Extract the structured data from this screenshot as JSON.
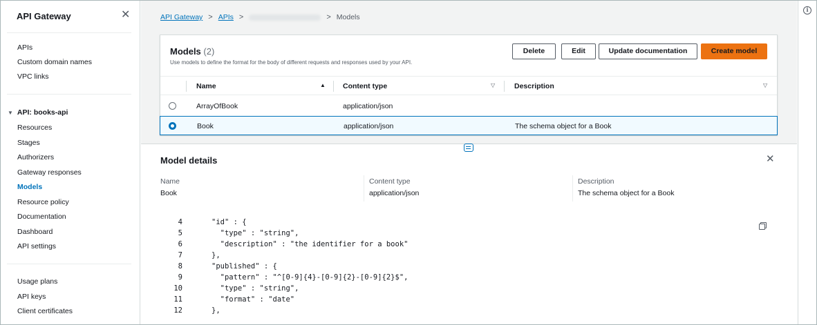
{
  "sidebar": {
    "title": "API Gateway",
    "close_glyph": "✕",
    "top_items": [
      "APIs",
      "Custom domain names",
      "VPC links"
    ],
    "api_section": "API: books-api",
    "api_items": [
      "Resources",
      "Stages",
      "Authorizers",
      "Gateway responses",
      "Models",
      "Resource policy",
      "Documentation",
      "Dashboard",
      "API settings"
    ],
    "active_item": "Models",
    "bottom_items": [
      "Usage plans",
      "API keys",
      "Client certificates"
    ]
  },
  "breadcrumb": {
    "root": "API Gateway",
    "apis": "APIs",
    "current": "Models",
    "sep": ">"
  },
  "models_panel": {
    "title": "Models",
    "count": "(2)",
    "subtitle": "Use models to define the format for the body of different requests and responses used by your API.",
    "buttons": {
      "delete": "Delete",
      "edit": "Edit",
      "update_docs": "Update documentation",
      "create": "Create model"
    },
    "columns": [
      "Name",
      "Content type",
      "Description"
    ],
    "rows": [
      {
        "name": "ArrayOfBook",
        "content_type": "application/json",
        "description": "",
        "selected": false
      },
      {
        "name": "Book",
        "content_type": "application/json",
        "description": "The schema object for a Book",
        "selected": true
      }
    ]
  },
  "details": {
    "title": "Model details",
    "close_glyph": "✕",
    "fields": [
      {
        "label": "Name",
        "value": "Book"
      },
      {
        "label": "Content type",
        "value": "application/json"
      },
      {
        "label": "Description",
        "value": "The schema object for a Book"
      }
    ],
    "code_lines": [
      {
        "n": "4",
        "text": "\"id\" : {"
      },
      {
        "n": "5",
        "text": "  \"type\" : \"string\","
      },
      {
        "n": "6",
        "text": "  \"description\" : \"the identifier for a book\""
      },
      {
        "n": "7",
        "text": "},"
      },
      {
        "n": "8",
        "text": "\"published\" : {"
      },
      {
        "n": "9",
        "text": "  \"pattern\" : \"^[0-9]{4}-[0-9]{2}-[0-9]{2}$\","
      },
      {
        "n": "10",
        "text": "  \"type\" : \"string\","
      },
      {
        "n": "11",
        "text": "  \"format\" : \"date\""
      },
      {
        "n": "12",
        "text": "},"
      }
    ]
  },
  "icons": {
    "info": "i",
    "sort_asc": "▲",
    "sort_desc": "▽"
  },
  "colors": {
    "link": "#0073bb",
    "primary_button": "#ec7211",
    "selected_row_bg": "#f1faff",
    "selected_border": "#0073bb"
  }
}
